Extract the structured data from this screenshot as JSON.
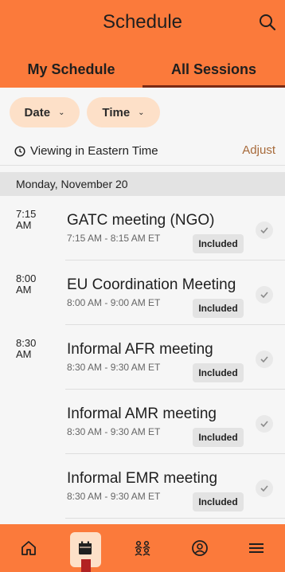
{
  "header": {
    "title": "Schedule",
    "search_icon": "search-icon"
  },
  "tabs": [
    {
      "label": "My Schedule",
      "active": false
    },
    {
      "label": "All Sessions",
      "active": true
    }
  ],
  "filters": {
    "date_label": "Date",
    "time_label": "Time"
  },
  "timezone": {
    "text": "Viewing in Eastern Time",
    "adjust_label": "Adjust"
  },
  "day": {
    "label": "Monday, November 20"
  },
  "sessions": [
    {
      "time": "7:15 AM",
      "title": "GATC meeting (NGO)",
      "range": "7:15 AM - 8:15 AM ET",
      "badge": "Included"
    },
    {
      "time": "8:00 AM",
      "title": "EU Coordination Meeting",
      "range": "8:00 AM - 9:00 AM ET",
      "badge": "Included"
    },
    {
      "time": "8:30 AM",
      "title": "Informal AFR meeting",
      "range": "8:30 AM - 9:30 AM ET",
      "badge": "Included"
    },
    {
      "time": "",
      "title": "Informal AMR meeting",
      "range": "8:30 AM - 9:30 AM ET",
      "badge": "Included"
    },
    {
      "time": "",
      "title": "Informal EMR meeting",
      "range": "8:30 AM - 9:30 AM ET",
      "badge": "Included"
    }
  ],
  "bottom_nav": [
    {
      "icon": "home-icon",
      "active": false
    },
    {
      "icon": "calendar-icon",
      "active": true
    },
    {
      "icon": "people-icon",
      "active": false
    },
    {
      "icon": "profile-icon",
      "active": false
    },
    {
      "icon": "menu-icon",
      "active": false
    }
  ],
  "colors": {
    "brand": "#fb7a3b",
    "chip": "#fde0c8",
    "tab_underline": "#7a2a14",
    "adjust_link": "#a76a3a"
  }
}
